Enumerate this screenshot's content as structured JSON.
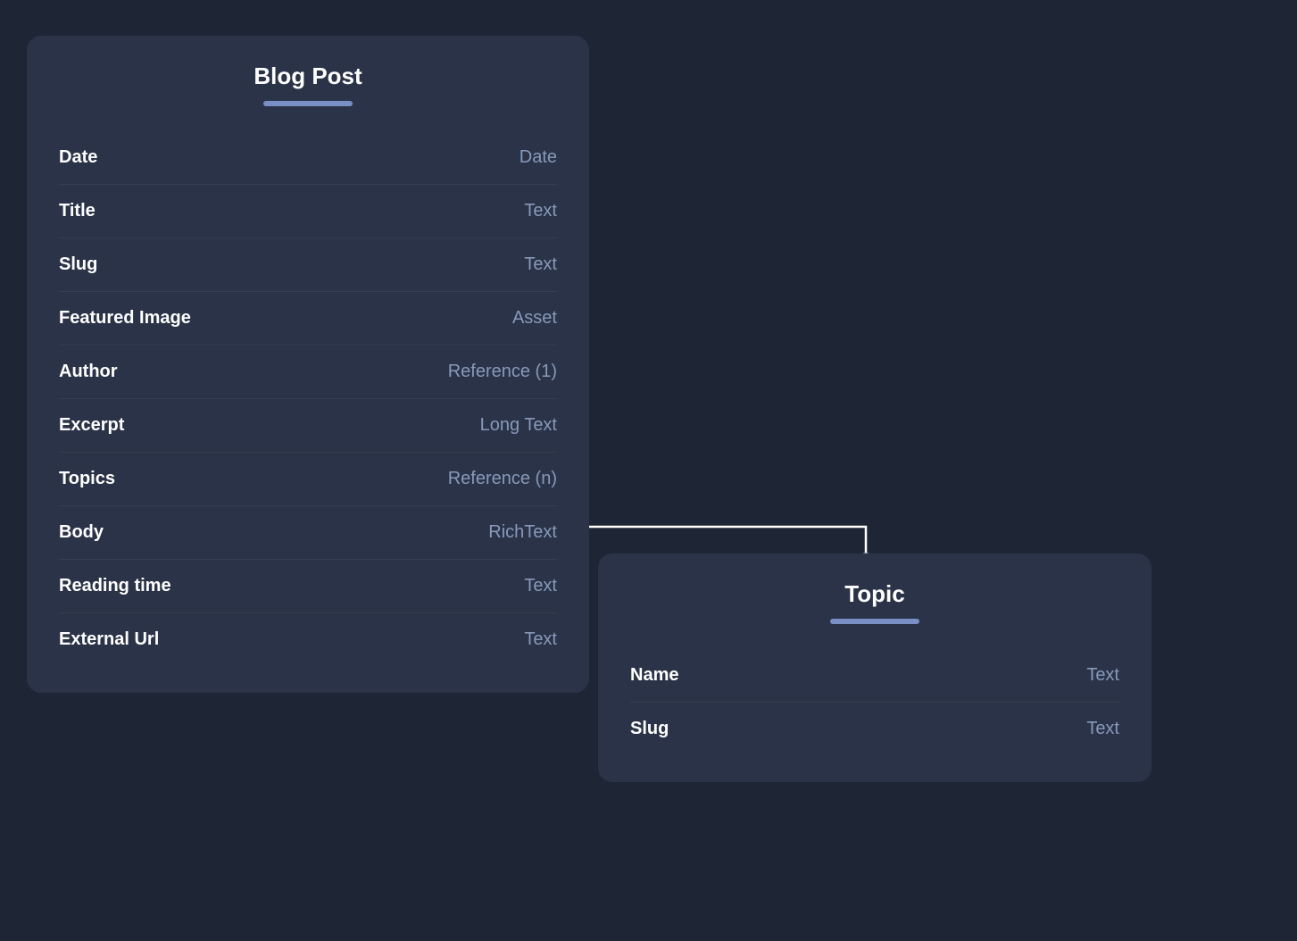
{
  "background_color": "#1e2535",
  "blog_post_card": {
    "title": "Blog Post",
    "fields": [
      {
        "name": "Date",
        "type": "Date"
      },
      {
        "name": "Title",
        "type": "Text"
      },
      {
        "name": "Slug",
        "type": "Text"
      },
      {
        "name": "Featured Image",
        "type": "Asset"
      },
      {
        "name": "Author",
        "type": "Reference (1)"
      },
      {
        "name": "Excerpt",
        "type": "Long Text"
      },
      {
        "name": "Topics",
        "type": "Reference (n)"
      },
      {
        "name": "Body",
        "type": "RichText"
      },
      {
        "name": "Reading time",
        "type": "Text"
      },
      {
        "name": "External Url",
        "type": "Text"
      }
    ]
  },
  "topic_card": {
    "title": "Topic",
    "fields": [
      {
        "name": "Name",
        "type": "Text"
      },
      {
        "name": "Slug",
        "type": "Text"
      }
    ]
  }
}
